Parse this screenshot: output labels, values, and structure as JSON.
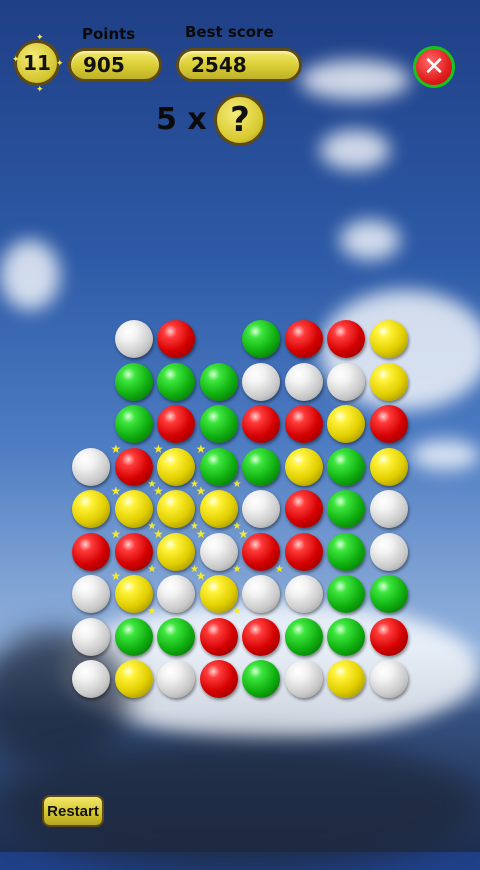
{
  "header": {
    "level": "11",
    "points_label": "Points",
    "points_value": "905",
    "best_label": "Best score",
    "best_value": "2548",
    "multiplier": "5 x",
    "hint_symbol": "?",
    "close_icon": "close-icon"
  },
  "footer": {
    "restart_label": "Restart"
  },
  "board": {
    "columns": 8,
    "rows": 9,
    "colors": {
      "red": "#d40000",
      "green": "#10b010",
      "yellow": "#e2cf00",
      "white": "#d8d8d8",
      "accent": "#5e4a14"
    },
    "grid": [
      [
        null,
        "white",
        "red",
        null,
        "green",
        "red",
        "red",
        "yellow"
      ],
      [
        null,
        "green",
        "green",
        "green",
        "white",
        "white",
        "white",
        "yellow"
      ],
      [
        null,
        "green",
        "red",
        "green",
        "red",
        "red",
        "yellow",
        "red"
      ],
      [
        "white",
        "red",
        "yellow",
        "green",
        "green",
        "yellow",
        "green",
        "yellow"
      ],
      [
        "yellow",
        "yellow",
        "yellow",
        "yellow",
        "white",
        "red",
        "green",
        "white"
      ],
      [
        "red",
        "red",
        "yellow",
        "white",
        "red",
        "red",
        "green",
        "white"
      ],
      [
        "white",
        "yellow",
        "white",
        "yellow",
        "white",
        "white",
        "green",
        "green"
      ],
      [
        "white",
        "green",
        "green",
        "red",
        "red",
        "green",
        "green",
        "red"
      ],
      [
        "white",
        "yellow",
        "white",
        "red",
        "green",
        "white",
        "yellow",
        "white"
      ]
    ],
    "selected": [
      [
        3,
        1
      ],
      [
        3,
        2
      ],
      [
        3,
        3
      ],
      [
        4,
        1
      ],
      [
        4,
        2
      ],
      [
        4,
        3
      ],
      [
        5,
        1
      ],
      [
        5,
        2
      ],
      [
        5,
        3
      ],
      [
        5,
        4
      ],
      [
        6,
        1
      ],
      [
        6,
        3
      ]
    ]
  }
}
